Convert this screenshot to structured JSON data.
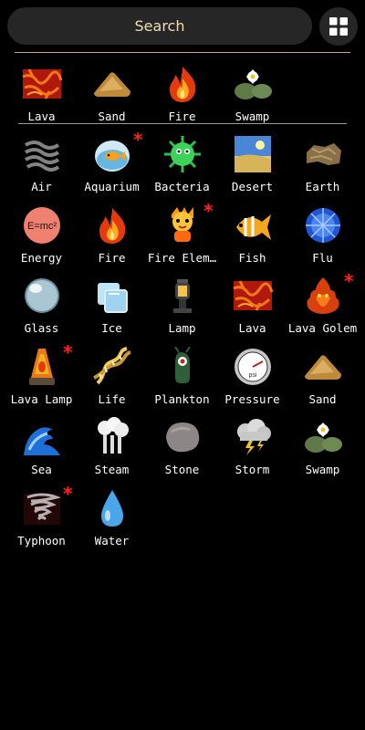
{
  "search": {
    "label": "Search"
  },
  "recent": [
    {
      "label": "Lava",
      "icon": "lava-icon",
      "star": false
    },
    {
      "label": "Sand",
      "icon": "sand-icon",
      "star": false
    },
    {
      "label": "Fire",
      "icon": "fire-icon",
      "star": false
    },
    {
      "label": "Swamp",
      "icon": "swamp-icon",
      "star": false
    }
  ],
  "elements": [
    {
      "label": "Air",
      "icon": "air-icon",
      "star": false
    },
    {
      "label": "Aquarium",
      "icon": "aquarium-icon",
      "star": true
    },
    {
      "label": "Bacteria",
      "icon": "bacteria-icon",
      "star": false
    },
    {
      "label": "Desert",
      "icon": "desert-icon",
      "star": false
    },
    {
      "label": "Earth",
      "icon": "earth-icon",
      "star": false
    },
    {
      "label": "Energy",
      "icon": "energy-icon",
      "star": false
    },
    {
      "label": "Fire",
      "icon": "fire-icon",
      "star": false
    },
    {
      "label": "Fire Elem…",
      "icon": "fire-elemental-icon",
      "star": true
    },
    {
      "label": "Fish",
      "icon": "fish-icon",
      "star": false
    },
    {
      "label": "Flu",
      "icon": "flu-icon",
      "star": false
    },
    {
      "label": "Glass",
      "icon": "glass-icon",
      "star": false
    },
    {
      "label": "Ice",
      "icon": "ice-icon",
      "star": false
    },
    {
      "label": "Lamp",
      "icon": "lamp-icon",
      "star": false
    },
    {
      "label": "Lava",
      "icon": "lava-icon",
      "star": false
    },
    {
      "label": "Lava Golem",
      "icon": "lava-golem-icon",
      "star": true
    },
    {
      "label": "Lava Lamp",
      "icon": "lava-lamp-icon",
      "star": true
    },
    {
      "label": "Life",
      "icon": "life-icon",
      "star": false
    },
    {
      "label": "Plankton",
      "icon": "plankton-icon",
      "star": false
    },
    {
      "label": "Pressure",
      "icon": "pressure-icon",
      "star": false
    },
    {
      "label": "Sand",
      "icon": "sand-icon",
      "star": false
    },
    {
      "label": "Sea",
      "icon": "sea-icon",
      "star": false
    },
    {
      "label": "Steam",
      "icon": "steam-icon",
      "star": false
    },
    {
      "label": "Stone",
      "icon": "stone-icon",
      "star": false
    },
    {
      "label": "Storm",
      "icon": "storm-icon",
      "star": false
    },
    {
      "label": "Swamp",
      "icon": "swamp-icon",
      "star": false
    },
    {
      "label": "Typhoon",
      "icon": "typhoon-icon",
      "star": true
    },
    {
      "label": "Water",
      "icon": "water-icon",
      "star": false
    }
  ],
  "new_marker": "*",
  "colors": {
    "accent": "#c7a472",
    "search_text": "#f3ddb1",
    "new_marker": "#ff2020"
  }
}
